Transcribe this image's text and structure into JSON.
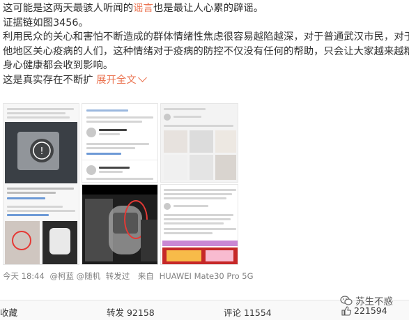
{
  "post": {
    "line1_a": "这可能是这两天最骇人听闻的",
    "line1_red": "谣言",
    "line1_b": "也是最让人心累的辟谣。",
    "line2": "证据链如图3456。",
    "line3": "利用民众的关心和害怕不断造成的群体情绪性焦虑很容易越陷越深，对于普通武汉市民，对于其",
    "line4": "他地区关心疫病的人们，这种情绪对于疫病的防控不仅没有任何的帮助，只会让大家越来越糟，",
    "line5": "身心健康都会收到影响。",
    "line6": "这是真实存在不断扩",
    "expand_label": "展开全文"
  },
  "meta": {
    "time": "今天 18:44",
    "authors": "@柯蓝 @随机",
    "action": "转发过",
    "source_prefix": "来自",
    "device": "HUAWEI Mate30 Pro 5G"
  },
  "actions": {
    "favorite": "收藏",
    "repost": "转发 92158",
    "comment": "评论 11554",
    "like": "221594"
  },
  "watermark": {
    "text": "苏生不惑"
  },
  "colors": {
    "accent": "#eb7350",
    "meta": "#808080",
    "border": "#e6e6e6"
  },
  "icons": [
    "chevron-down-icon",
    "thumbs-up-icon",
    "wechat-icon",
    "play-icon"
  ]
}
